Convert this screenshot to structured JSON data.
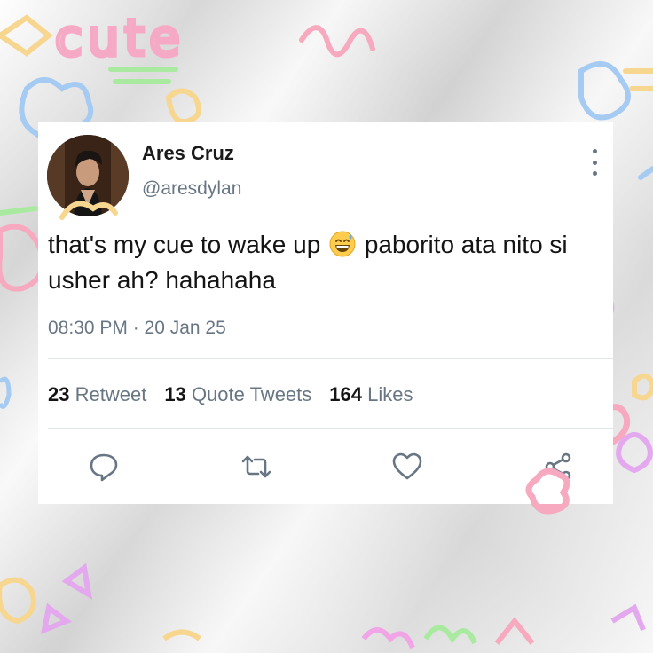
{
  "tweet": {
    "name": "Ares Cruz",
    "handle": "@aresdylan",
    "text_before_emoji": "that's my cue to wake up",
    "emoji": "grinning-face-with-sweat-icon",
    "text_after_emoji": "paborito ata nito si usher ah? hahahaha",
    "timestamp": "08:30 PM · 20 Jan 25"
  },
  "stats": {
    "retweets_count": "23",
    "retweets_label": "Retweet",
    "quotes_count": "13",
    "quotes_label": "Quote Tweets",
    "likes_count": "164",
    "likes_label": "Likes"
  },
  "decor": {
    "doodle_word": "cute"
  },
  "colors": {
    "muted_text": "#687684",
    "primary_text": "#141414",
    "card_bg": "#ffffff"
  }
}
